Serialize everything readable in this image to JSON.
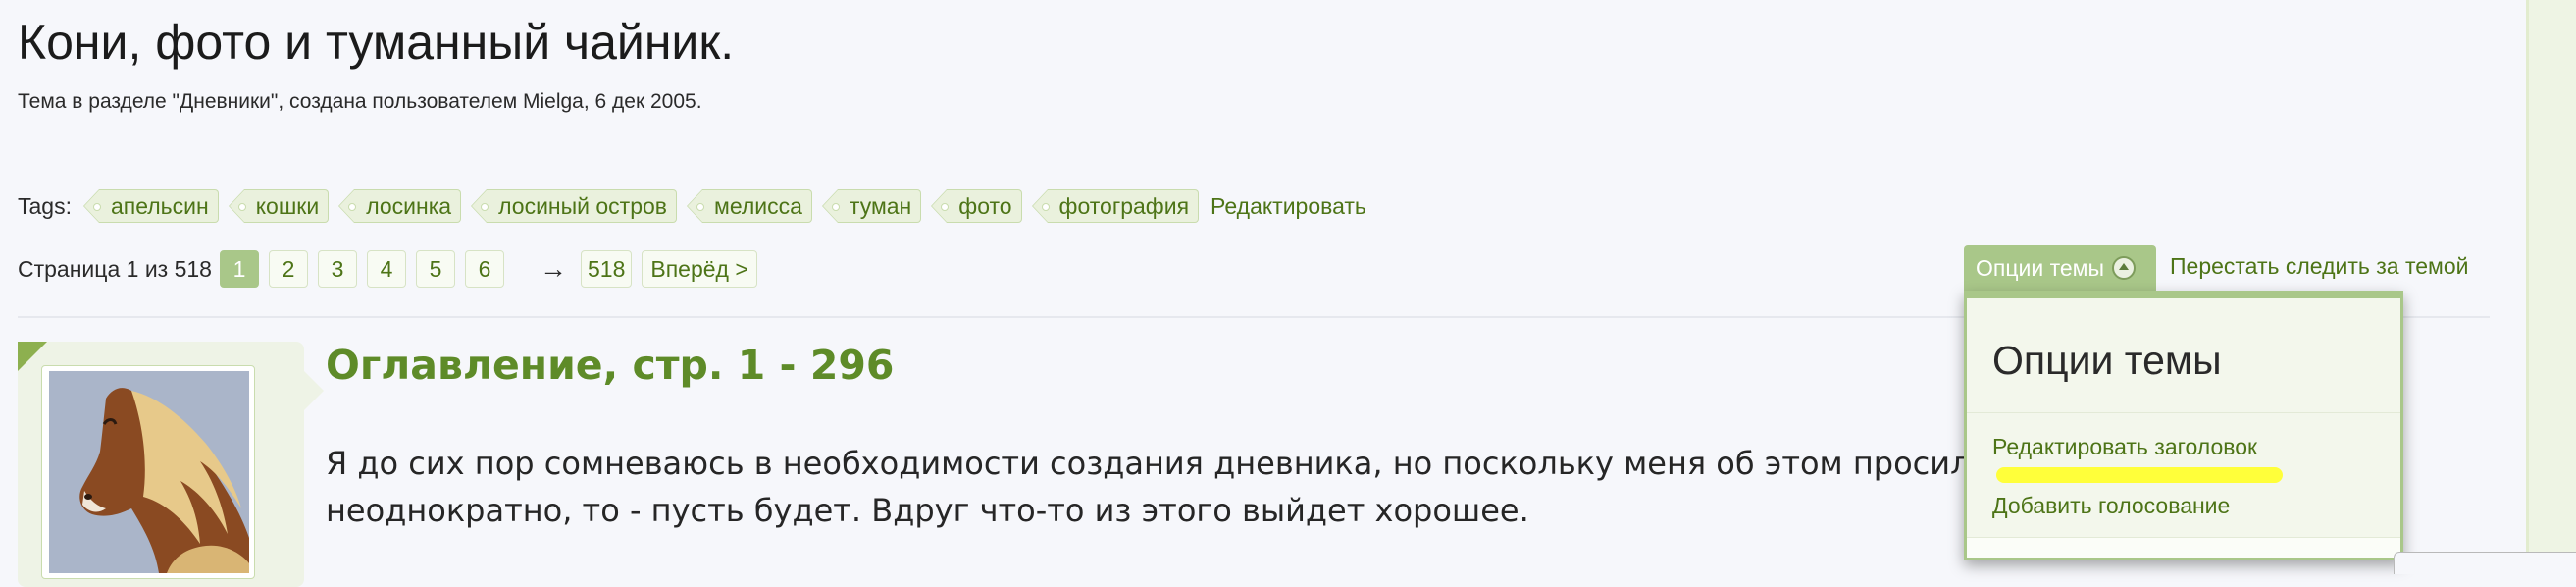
{
  "thread": {
    "title": "Кони, фото и туманный чайник.",
    "description": "Тема в разделе \"Дневники\", создана пользователем Mielga, 6 дек 2005."
  },
  "tags": {
    "label": "Tags:",
    "items": [
      "апельсин",
      "кошки",
      "лосинка",
      "лосиный остров",
      "мелисса",
      "туман",
      "фото",
      "фотография"
    ],
    "edit_label": "Редактировать"
  },
  "pagination": {
    "label": "Страница 1 из 518",
    "pages": [
      "1",
      "2",
      "3",
      "4",
      "5",
      "6"
    ],
    "current": "1",
    "arrow": "→",
    "last": "518",
    "next_label": "Вперёд >"
  },
  "thread_tools": {
    "options_label": "Опции темы",
    "unfollow_label": "Перестать следить за темой"
  },
  "options_menu": {
    "title": "Опции темы",
    "items": [
      "Редактировать заголовок",
      "Добавить голосование"
    ]
  },
  "post": {
    "title": "Оглавление, стр. 1 - 296",
    "body": "Я до сих пор сомневаюсь в необходимости создания дневника, но поскольку меня об этом просили, причём ещё и неоднократно, то - пусть будет. Вдруг что-то из этого выйдет хорошее."
  },
  "colors": {
    "accent": "#a9c789",
    "link": "#4d7417",
    "post_title": "#5e8b28",
    "highlight": "#ffff3a"
  }
}
